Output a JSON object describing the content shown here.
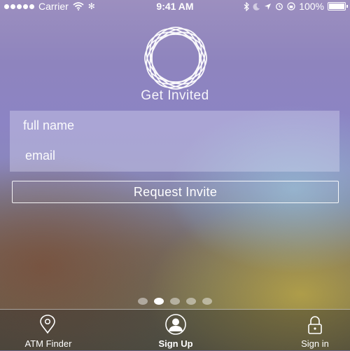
{
  "status_bar": {
    "carrier": "Carrier",
    "time": "9:41 AM",
    "battery": "100%",
    "signal_bars": 5,
    "icons": [
      "wifi-icon",
      "bluetooth-icon",
      "moon-icon",
      "location-icon",
      "alarm-icon",
      "battery-icon"
    ]
  },
  "header": {
    "title": "Get Invited",
    "logo_icon": "ring-logo-icon"
  },
  "form": {
    "name_placeholder": "full name",
    "email_placeholder": "email",
    "submit_label": "Request Invite"
  },
  "pager": {
    "count": 5,
    "active_index": 1
  },
  "tab_bar": {
    "items": [
      {
        "label": "ATM Finder",
        "icon": "location-pin-icon"
      },
      {
        "label": "Sign Up",
        "icon": "user-icon"
      },
      {
        "label": "Sign in",
        "icon": "lock-icon"
      }
    ]
  }
}
